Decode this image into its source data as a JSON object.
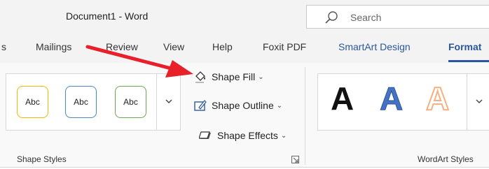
{
  "titlebar": {
    "doc_title": "Document1  -  Word",
    "search_label": "Search"
  },
  "tabs": {
    "partial": "s",
    "mailings": "Mailings",
    "review": "Review",
    "view": "View",
    "help": "Help",
    "foxit": "Foxit PDF",
    "smartart": "SmartArt Design",
    "format": "Format"
  },
  "shape_styles": {
    "presets": [
      {
        "label": "Abc",
        "border": "#f2b900"
      },
      {
        "label": "Abc",
        "border": "#4a86c8"
      },
      {
        "label": "Abc",
        "border": "#6aa84f"
      }
    ],
    "shape_fill": "Shape Fill",
    "shape_outline": "Shape Outline",
    "shape_effects": "Shape Effects",
    "group_label": "Shape Styles"
  },
  "wordart": {
    "letters": [
      {
        "char": "A",
        "color": "#111111"
      },
      {
        "char": "A",
        "color": "#4472c4"
      },
      {
        "char": "A",
        "color": "#f4b183"
      }
    ],
    "group_label": "WordArt Styles"
  },
  "colors": {
    "accent": "#2b579a",
    "annotation_arrow": "#e8202a"
  }
}
